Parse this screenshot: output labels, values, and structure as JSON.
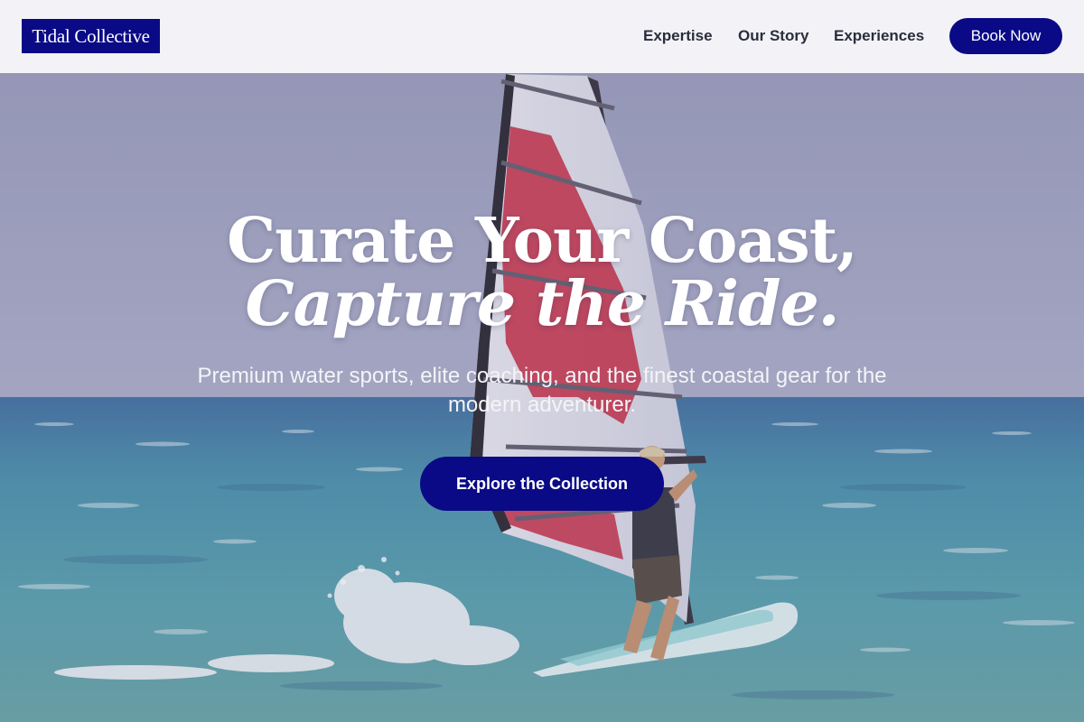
{
  "header": {
    "logo_text": "Tidal Collective",
    "nav": {
      "expertise": "Expertise",
      "our_story": "Our Story",
      "experiences": "Experiences"
    },
    "book_label": "Book Now"
  },
  "hero": {
    "title_line1": "Curate Your Coast,",
    "title_line2": "Capture the Ride.",
    "subtitle": "Premium water sports, elite coaching, and the finest coastal gear for the modern adventurer.",
    "cta_label": "Explore the Collection",
    "image_subject": "windsurfer-on-ocean"
  },
  "colors": {
    "brand": "#0a0a86",
    "header_bg": "#f6f6f9",
    "nav_text": "#2a2d3c",
    "sky": "#8f93b1",
    "sea": "#3f8ea0"
  }
}
